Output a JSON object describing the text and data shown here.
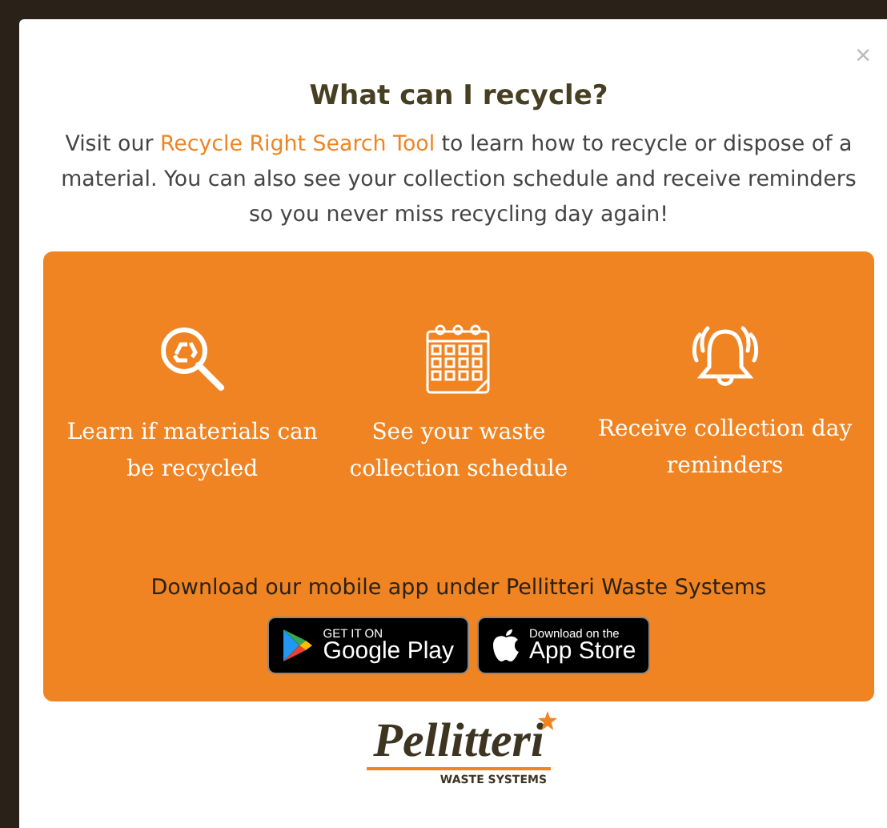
{
  "modal": {
    "close": "×",
    "title": "What can I recycle?",
    "intro": {
      "before": "Visit our ",
      "link": "Recycle Right Search Tool",
      "after": " to learn how to recycle or dispose of a material. You can also see your collection schedule and receive reminders so you never miss recycling day again!"
    },
    "features": [
      {
        "label": "Learn if materials can be recycled"
      },
      {
        "label": "See your waste collection schedule"
      },
      {
        "label": "Receive collection day reminders"
      }
    ],
    "download_text": "Download our mobile app under Pellitteri Waste Systems",
    "store_buttons": [
      {
        "small": "GET IT ON",
        "big": "Google Play"
      },
      {
        "small": "Download on the",
        "big": "App Store"
      }
    ],
    "logo": {
      "name": "Pellitteri",
      "tagline": "WASTE SYSTEMS"
    }
  }
}
